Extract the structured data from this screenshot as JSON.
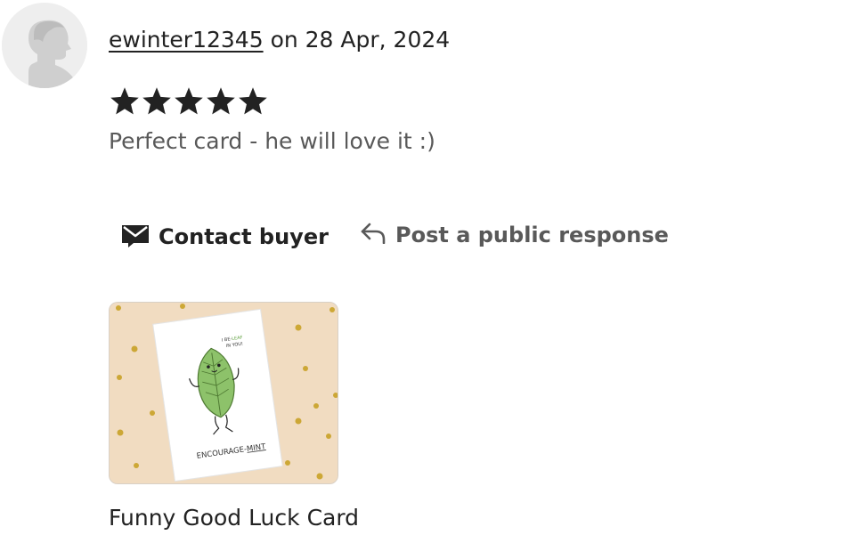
{
  "review": {
    "username": "ewinter12345",
    "date_text": "on 28 Apr, 2024",
    "rating": 5,
    "rating_max": 5,
    "text": "Perfect card - he will love it :)"
  },
  "actions": {
    "contact_label": "Contact buyer",
    "respond_label": "Post a public response"
  },
  "product": {
    "title": "Funny Good Luck Card",
    "card_text_top_1": "I BE-",
    "card_text_top_leaf": "LEAF",
    "card_text_top_2": "IN YOU!",
    "card_text_bottom_1": "ENCOURAGE-",
    "card_text_bottom_2": "MINT"
  },
  "colors": {
    "leaf_green": "#8dc26a",
    "thumb_background": "#f1dcc1",
    "dots_gold": "#c9a227"
  },
  "icons": {
    "avatar": "default-avatar-icon",
    "star": "star-icon",
    "contact": "envelope-icon",
    "respond": "reply-arrow-icon"
  }
}
